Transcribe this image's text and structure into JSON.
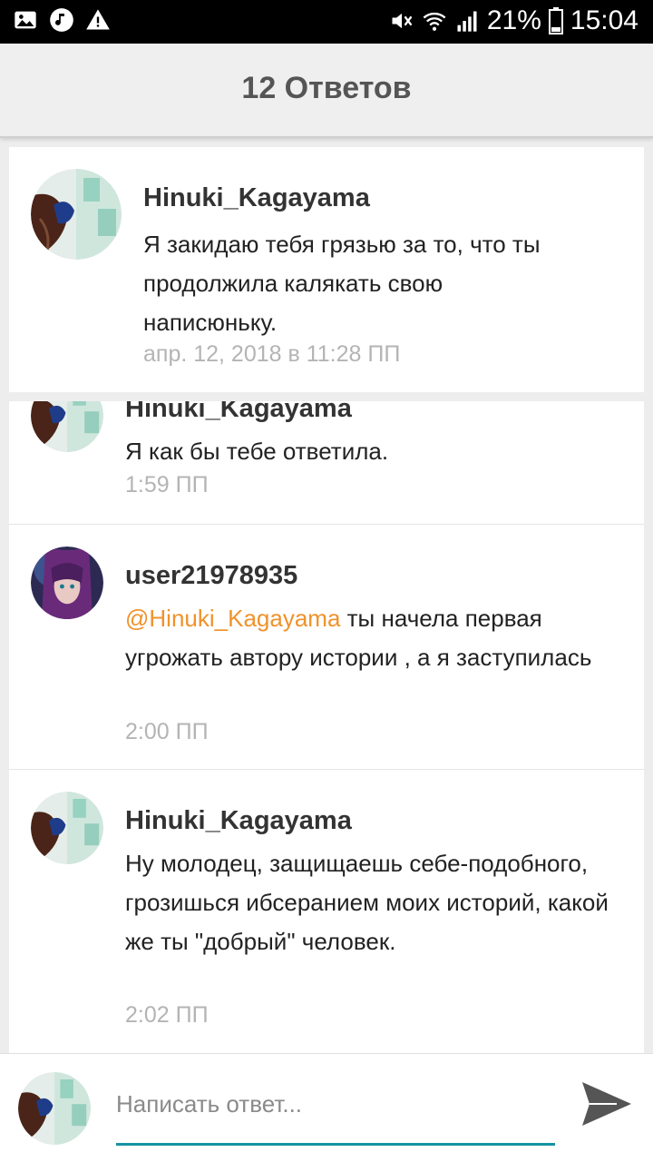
{
  "status_bar": {
    "battery": "21%",
    "time": "15:04",
    "icons": [
      "image-icon",
      "music-icon",
      "warning-icon",
      "mute-icon",
      "wifi-icon",
      "signal-icon",
      "battery-icon"
    ]
  },
  "header": {
    "title": "12 Ответов"
  },
  "parent_comment": {
    "author": "Hinuki_Kagayama",
    "text": "Я закидаю тебя грязью за то, что ты продолжила калякать свою написюньку.",
    "time": "апр. 12, 2018 в 11:28 ПП"
  },
  "replies": [
    {
      "author": "Hinuki_Kagayama",
      "text": "Я как бы тебе ответила.",
      "time": "1:59 ПП"
    },
    {
      "author": "user21978935",
      "mention": "@Hinuki_Kagayama",
      "text": "ты начела первая угрожать автору истории , а я заступилась",
      "time": "2:00 ПП"
    },
    {
      "author": "Hinuki_Kagayama",
      "text": "Ну молодец, защищаешь себе-подобного, грозишься ибсеранием моих историй, какой же ты \"добрый\" человек.",
      "time": "2:02 ПП"
    }
  ],
  "composer": {
    "placeholder": "Написать ответ..."
  },
  "colors": {
    "accent": "#1593a3",
    "mention": "#f0922b",
    "timestamp": "#b4b4b4"
  }
}
